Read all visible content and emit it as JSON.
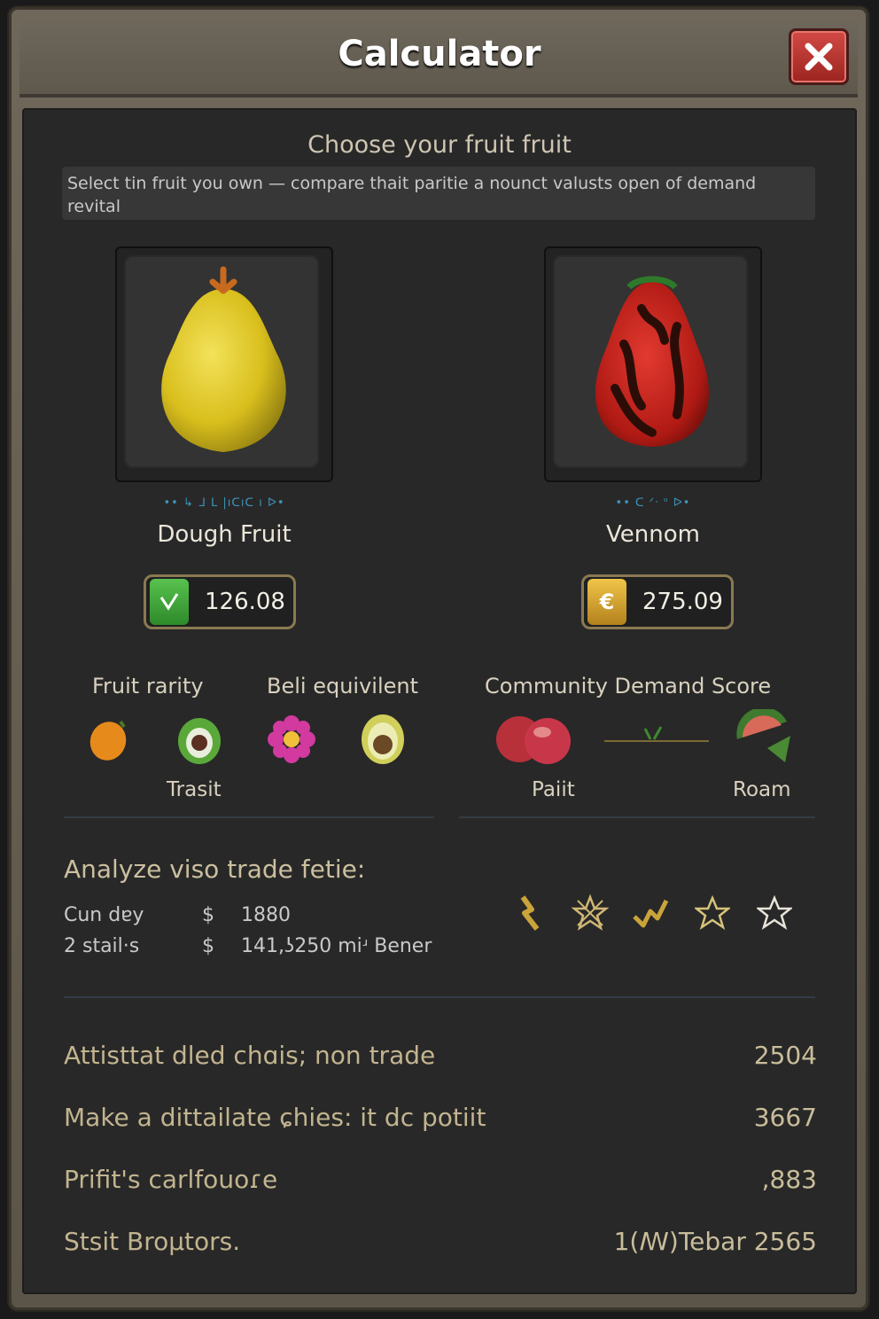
{
  "window": {
    "title": "Calculator"
  },
  "header": {
    "subtitle": "Choose your fruit fruit",
    "description": "Select tin fruit you own — compare thait paritie a nounct valusts open of demand revital"
  },
  "fruits": [
    {
      "tiny_text": "•• ↳ ᒧ ᒪ |ıᑕıᑕ ı ᐅ•",
      "name": "Dough Fruit",
      "value": "126.08",
      "value_icon": "check-arrow-icon",
      "icon_color": "#3fa63a"
    },
    {
      "tiny_text": "•• ᑕ ᐟᐧ ᐡ ᐅ•",
      "name": "Vennom",
      "value": "275.09",
      "value_icon": "euro-coin-icon",
      "icon_color": "#d8a227"
    }
  ],
  "attributes": {
    "fruit_rarity_label": "Fruit rarity",
    "beli_label": "Beli equivilent",
    "demand_label": "Community Demand Score",
    "trasit_label": "Trasit",
    "paiit_label": "Paiit",
    "roam_label": "Roam"
  },
  "analyze": {
    "title": "Analyze viso trade fetie:",
    "rows": [
      {
        "label": "Cun dɐy",
        "currency": "$",
        "value": "1880"
      },
      {
        "label": "2 stail·s",
        "currency": "$",
        "value": "141,ʖ250 miʴ  Bener"
      }
    ],
    "stars": [
      "bolt-icon",
      "spark-star-icon",
      "check-swirl-icon",
      "star-outline-icon",
      "star-outline-icon"
    ]
  },
  "stats": [
    {
      "label": "Attisttat dled chɑis; non trade",
      "value": "2504"
    },
    {
      "label": "Make a dittailate ɕhies: it dc potiit",
      "value": "3667"
    },
    {
      "label": "Prifit's carlfouoɾe",
      "value": ",883"
    },
    {
      "label": "Stsit Broμtors.",
      "value": "1(ꟿ)Tebar  2565"
    }
  ]
}
